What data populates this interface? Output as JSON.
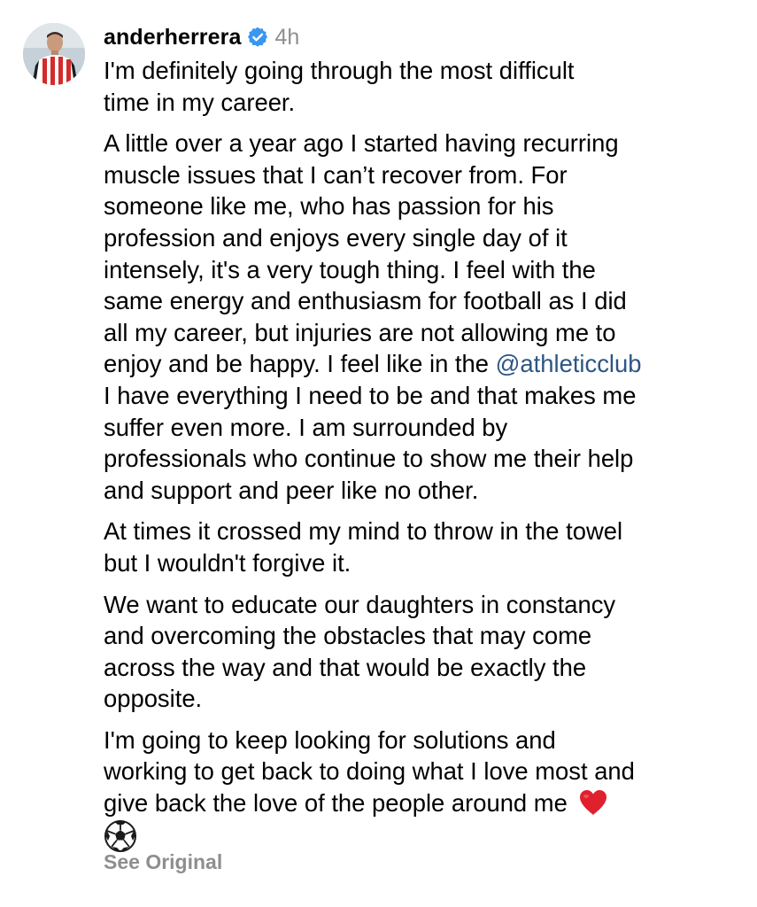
{
  "comment": {
    "username": "anderherrera",
    "timestamp": "4h",
    "mention": "@athleticclub",
    "paragraphs": {
      "p1": [
        "I'm definitely going through the most difficult",
        "time in my career."
      ],
      "p2": [
        "A little over a year ago I started having recurring",
        "muscle issues that I can’t recover from. For",
        "someone like me, who has passion for his",
        "profession and enjoys every single day of it",
        "intensely, it's a very tough thing. I feel with the",
        "same energy and enthusiasm for football as I did",
        "all my career, but injuries are not allowing me to",
        "enjoy and be happy. I feel like in the ",
        "I have everything I need to be and that makes me",
        "suffer even more. I am surrounded by",
        "professionals who continue to show me their help",
        "and support and peer like no other."
      ],
      "p3": [
        "At times it crossed my mind to throw in the towel",
        "but I wouldn't forgive it."
      ],
      "p4": [
        "We want to educate our daughters in constancy",
        "and overcoming the obstacles that may come",
        "across the way and that would be exactly the",
        "opposite."
      ],
      "p5": [
        "I'm going to keep looking for solutions and",
        "working to get back to doing what I love most and",
        "give back the love of the people around me "
      ]
    },
    "see_original": "See Original"
  },
  "icons": {
    "verified": "verified-badge-icon",
    "heart": "red-heart-emoji",
    "ball": "soccer-ball-emoji"
  },
  "colors": {
    "username": "#000000",
    "timestamp": "#8e8e8e",
    "mention": "#2c5684",
    "see_original": "#8e8e8e",
    "verified": "#3897f0",
    "heart": "#e0202d"
  }
}
